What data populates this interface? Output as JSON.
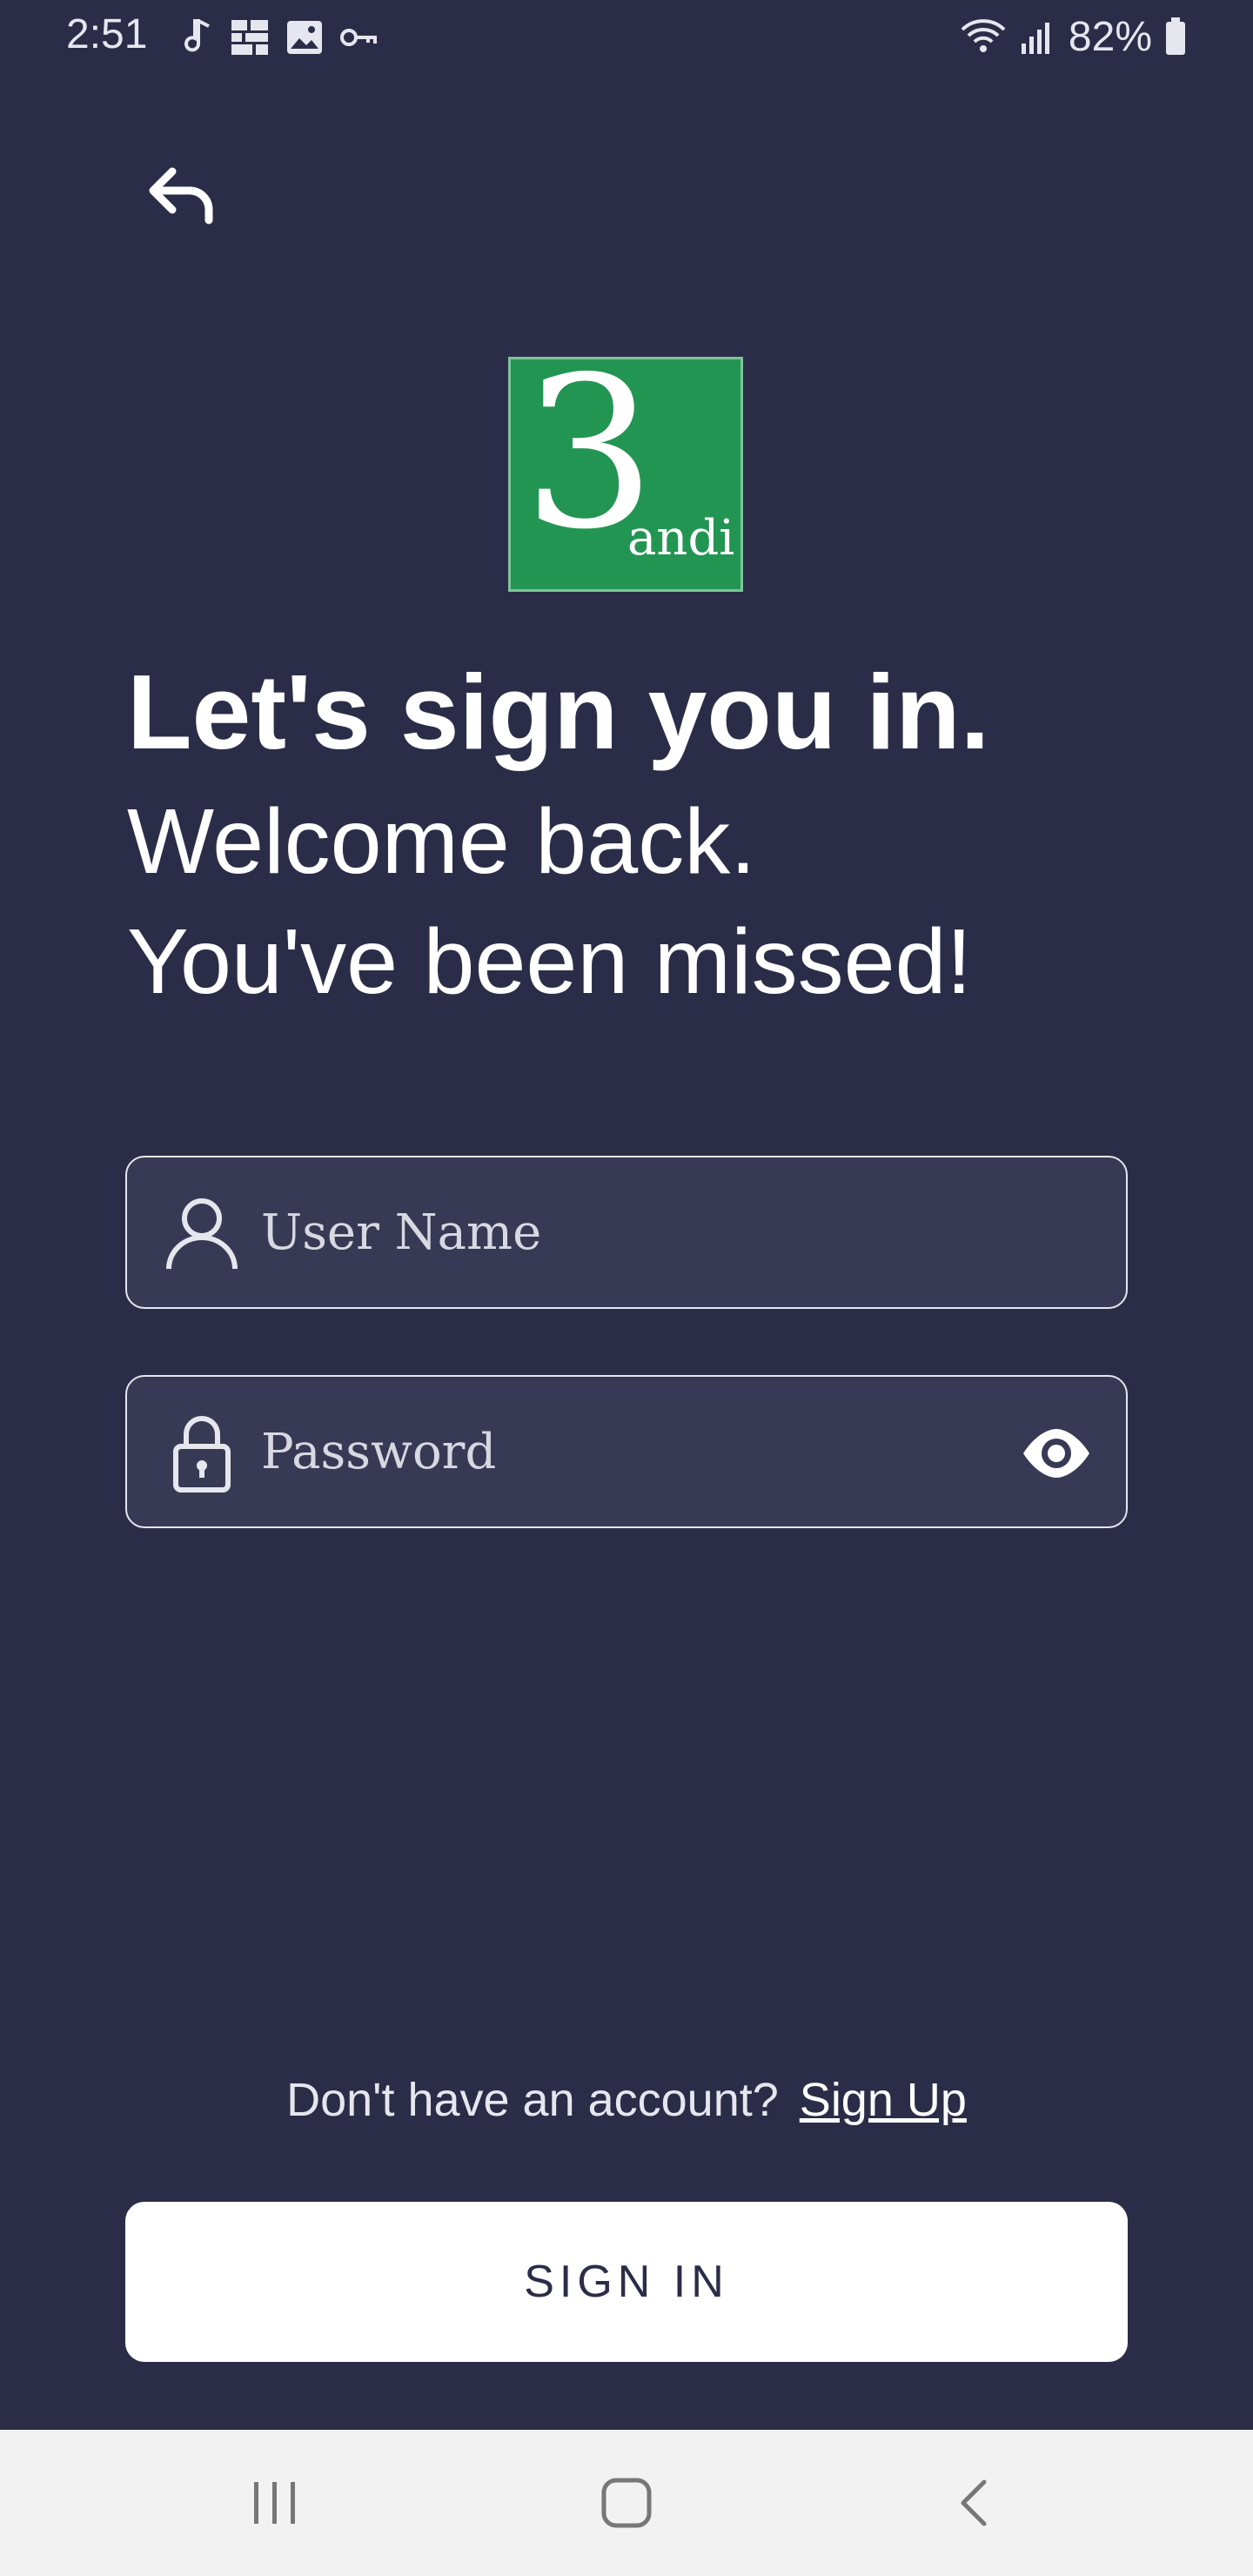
{
  "status_bar": {
    "time": "2:51",
    "battery": "82%",
    "left_icons": [
      "music-note-icon",
      "gallery-grid-icon",
      "image-icon",
      "key-icon"
    ],
    "right_icons": [
      "wifi-icon",
      "signal-icon",
      "battery-icon"
    ]
  },
  "logo": {
    "numeral": "3",
    "word": "andi",
    "color": "#239553"
  },
  "heading": {
    "line1": "Let's sign you in.",
    "line2": "Welcome back.",
    "line3": "You've been missed!"
  },
  "form": {
    "username_placeholder": "User Name",
    "password_placeholder": "Password"
  },
  "footer": {
    "prompt": "Don't have an account?",
    "signup_label": "Sign Up",
    "signin_label": "SIGN IN"
  },
  "colors": {
    "background": "#2b2d48",
    "field_bg": "#383a55",
    "text": "#ffffff"
  }
}
